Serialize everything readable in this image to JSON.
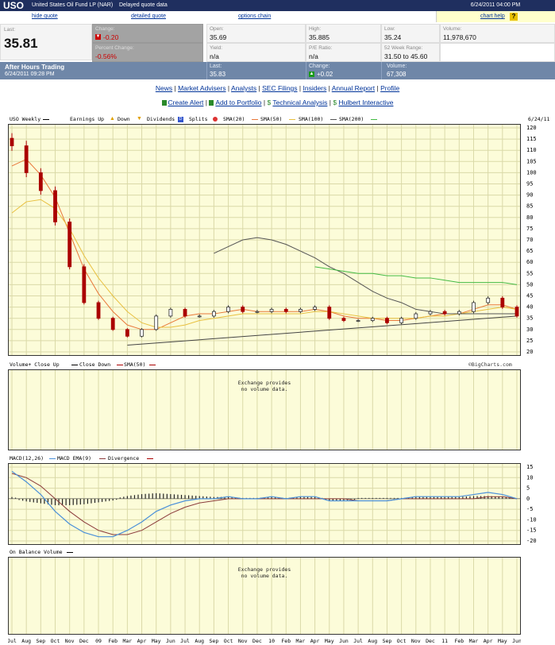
{
  "header": {
    "symbol": "USO",
    "name": "United States Oil Fund LP (NAR)",
    "delay": "Delayed quote data",
    "datetime": "6/24/2011 04:00 PM"
  },
  "links": {
    "hide_quote": "hide quote",
    "detailed_quote": "detailed quote",
    "options_chain": "options chain",
    "chart_help": "chart help",
    "help_icon": "?"
  },
  "quote": {
    "last_label": "Last:",
    "last": "35.81",
    "change_label": "Change:",
    "change": "-0.20",
    "pct_label": "Percent Change:",
    "pct": "-0.56%",
    "open_label": "Open:",
    "open": "35.69",
    "yield_label": "Yield:",
    "yield": "n/a",
    "high_label": "High:",
    "high": "35.885",
    "pe_label": "P/E Ratio:",
    "pe": "n/a",
    "low_label": "Low:",
    "low": "35.24",
    "range_label": "52 Week Range:",
    "range": "31.50 to 45.60",
    "volume_label": "Volume:",
    "volume": "11,978,670"
  },
  "after_hours": {
    "title": "After Hours Trading",
    "time": "6/24/2011 09:28 PM",
    "last_label": "Last:",
    "last": "35.83",
    "change_label": "Change:",
    "change": "+0.02",
    "volume_label": "Volume:",
    "volume": "67,308"
  },
  "nav": {
    "items": [
      "News",
      "Market Advisers",
      "Analysts",
      "SEC Filings",
      "Insiders",
      "Annual Report",
      "Profile"
    ],
    "tools": [
      "Create Alert",
      "Add to Portfolio",
      "Technical Analysis",
      "Hulbert Interactive"
    ],
    "sep": "|"
  },
  "price_panel": {
    "title": "USO Weekly",
    "legend": [
      "Earnings Up",
      "Down",
      "Dividends",
      "Splits",
      "SMA(20)",
      "SMA(50)",
      "SMA(100)",
      "SMA(200)"
    ],
    "dividend_glyph": "D",
    "date": "6/24/11"
  },
  "volume_panel": {
    "legend": [
      "Volume+ Close Up",
      "Close Down",
      "SMA(50)"
    ],
    "credit": "©BigCharts.com",
    "nodata1": "Exchange provides",
    "nodata2": "no volume data."
  },
  "macd_panel": {
    "legend": [
      "MACD(12,26)",
      "MACD EMA(9)",
      "Divergence"
    ]
  },
  "obv_panel": {
    "title": "On Balance Volume",
    "nodata1": "Exchange provides",
    "nodata2": "no volume data."
  },
  "x_labels": [
    "Jul",
    "Aug",
    "Sep",
    "Oct",
    "Nov",
    "Dec",
    "09",
    "Feb",
    "Mar",
    "Apr",
    "May",
    "Jun",
    "Jul",
    "Aug",
    "Sep",
    "Oct",
    "Nov",
    "Dec",
    "10",
    "Feb",
    "Mar",
    "Apr",
    "May",
    "Jun",
    "Jul",
    "Aug",
    "Sep",
    "Oct",
    "Nov",
    "Dec",
    "11",
    "Feb",
    "Mar",
    "Apr",
    "May",
    "Jun"
  ],
  "colors": {
    "up": "#333333",
    "down": "#aa0000",
    "sma20": "#e8783a",
    "sma50": "#e8c040",
    "sma100": "#555555",
    "sma200": "#44bb44",
    "macd": "#4a90d9",
    "ema": "#8b3a3a",
    "trend": "#444444"
  },
  "chart_data": [
    {
      "type": "line",
      "title": "USO Weekly",
      "ylim": [
        20,
        120
      ],
      "yticks": [
        20,
        25,
        30,
        35,
        40,
        45,
        50,
        55,
        60,
        65,
        70,
        75,
        80,
        85,
        90,
        95,
        100,
        105,
        110,
        115,
        120
      ],
      "x": [
        "2008-07",
        "2008-08",
        "2008-09",
        "2008-10",
        "2008-11",
        "2008-12",
        "2009-01",
        "2009-02",
        "2009-03",
        "2009-04",
        "2009-05",
        "2009-06",
        "2009-07",
        "2009-08",
        "2009-09",
        "2009-10",
        "2009-11",
        "2009-12",
        "2010-01",
        "2010-02",
        "2010-03",
        "2010-04",
        "2010-05",
        "2010-06",
        "2010-07",
        "2010-08",
        "2010-09",
        "2010-10",
        "2010-11",
        "2010-12",
        "2011-01",
        "2011-02",
        "2011-03",
        "2011-04",
        "2011-05",
        "2011-06"
      ],
      "series": [
        {
          "name": "Close",
          "values": [
            112,
            100,
            92,
            78,
            58,
            42,
            35,
            30,
            27,
            30,
            36,
            39,
            36,
            36,
            38,
            40,
            38,
            38,
            39,
            38,
            39,
            40,
            35,
            34,
            34,
            35,
            33,
            35,
            37,
            38,
            37,
            38,
            42,
            44,
            40,
            36
          ]
        },
        {
          "name": "SMA(20)",
          "values": [
            103,
            106,
            99,
            89,
            73,
            57,
            46,
            38,
            32,
            30,
            30,
            33,
            36,
            37,
            37,
            38,
            39,
            38,
            38,
            38,
            38,
            39,
            38,
            36,
            35,
            35,
            34,
            34,
            35,
            36,
            37,
            37,
            39,
            41,
            41,
            39
          ]
        },
        {
          "name": "SMA(50)",
          "values": [
            82,
            87,
            88,
            84,
            75,
            63,
            53,
            45,
            38,
            33,
            31,
            31,
            32,
            34,
            35,
            36,
            37,
            37,
            37,
            37,
            37,
            38,
            38,
            37,
            36,
            35,
            35,
            35,
            35,
            36,
            36,
            37,
            38,
            39,
            40,
            39
          ]
        },
        {
          "name": "SMA(100)",
          "values": [
            64,
            67,
            70,
            71,
            70,
            68,
            65,
            62,
            58,
            55,
            51,
            47,
            44,
            42,
            39,
            38,
            37,
            37,
            37,
            37,
            37,
            37
          ]
        },
        {
          "name": "SMA(200)",
          "values": [
            58,
            57,
            56,
            55,
            55,
            54,
            54,
            53,
            53,
            52,
            51,
            51,
            51,
            51,
            50
          ]
        }
      ]
    },
    {
      "type": "line",
      "title": "MACD(12,26)",
      "ylim": [
        -20,
        15
      ],
      "yticks": [
        15,
        10,
        5,
        0,
        -5,
        -10,
        -15,
        -20
      ],
      "x": [
        "2008-07",
        "2008-08",
        "2008-09",
        "2008-10",
        "2008-11",
        "2008-12",
        "2009-01",
        "2009-02",
        "2009-03",
        "2009-04",
        "2009-05",
        "2009-06",
        "2009-07",
        "2009-08",
        "2009-09",
        "2009-10",
        "2009-11",
        "2009-12",
        "2010-01",
        "2010-02",
        "2010-03",
        "2010-04",
        "2010-05",
        "2010-06",
        "2010-07",
        "2010-08",
        "2010-09",
        "2010-10",
        "2010-11",
        "2010-12",
        "2011-01",
        "2011-02",
        "2011-03",
        "2011-04",
        "2011-05",
        "2011-06"
      ],
      "series": [
        {
          "name": "MACD EMA(9)",
          "values": [
            12,
            10,
            6,
            0,
            -6,
            -11,
            -15,
            -17,
            -17,
            -15,
            -11,
            -7,
            -4,
            -2,
            -1,
            0,
            0,
            0,
            0,
            0,
            0,
            0,
            0,
            0,
            -1,
            -1,
            -1,
            0,
            0,
            0,
            0,
            0,
            0,
            1,
            1,
            0
          ]
        },
        {
          "name": "MACD",
          "values": [
            13,
            8,
            2,
            -6,
            -12,
            -16,
            -18,
            -18,
            -15,
            -11,
            -6,
            -3,
            -1,
            0,
            0,
            1,
            0,
            0,
            1,
            0,
            1,
            1,
            -1,
            -1,
            -1,
            -1,
            -1,
            0,
            1,
            1,
            1,
            1,
            2,
            3,
            2,
            0
          ]
        }
      ]
    }
  ]
}
